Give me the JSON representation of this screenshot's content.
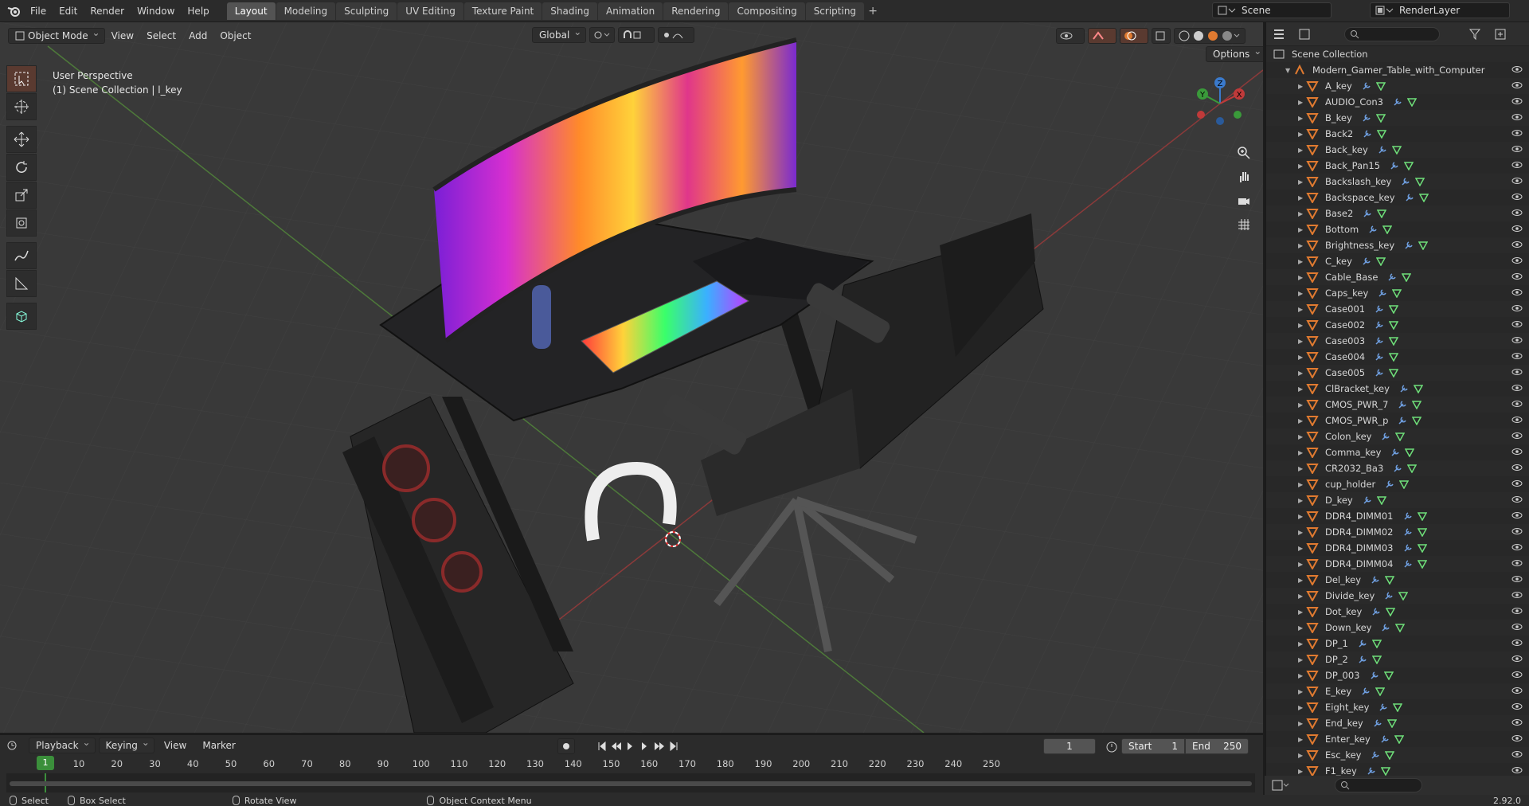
{
  "menubar": {
    "items": [
      "File",
      "Edit",
      "Render",
      "Window",
      "Help"
    ]
  },
  "workspaces": [
    "Layout",
    "Modeling",
    "Sculpting",
    "UV Editing",
    "Texture Paint",
    "Shading",
    "Animation",
    "Rendering",
    "Compositing",
    "Scripting"
  ],
  "active_workspace": "Layout",
  "scene": {
    "name": "Scene",
    "render_layer": "RenderLayer"
  },
  "viewport": {
    "mode": "Object Mode",
    "menus": [
      "View",
      "Select",
      "Add",
      "Object"
    ],
    "transform_orientation": "Global",
    "info_line1": "User Perspective",
    "info_line2": "(1) Scene Collection | l_key",
    "options_label": "Options"
  },
  "gizmo": {
    "x": "X",
    "y": "Y",
    "z": "Z"
  },
  "outliner": {
    "root": "Scene Collection",
    "collection": "Modern_Gamer_Table_with_Computer",
    "items": [
      "A_key",
      "AUDIO_Con3",
      "B_key",
      "Back2",
      "Back_key",
      "Back_Pan15",
      "Backslash_key",
      "Backspace_key",
      "Base2",
      "Bottom",
      "Brightness_key",
      "C_key",
      "Cable_Base",
      "Caps_key",
      "Case001",
      "Case002",
      "Case003",
      "Case004",
      "Case005",
      "ClBracket_key",
      "CMOS_PWR_7",
      "CMOS_PWR_p",
      "Colon_key",
      "Comma_key",
      "CR2032_Ba3",
      "cup_holder",
      "D_key",
      "DDR4_DIMM01",
      "DDR4_DIMM02",
      "DDR4_DIMM03",
      "DDR4_DIMM04",
      "Del_key",
      "Divide_key",
      "Dot_key",
      "Down_key",
      "DP_1",
      "DP_2",
      "DP_003",
      "E_key",
      "Eight_key",
      "End_key",
      "Enter_key",
      "Esc_key",
      "F1_key"
    ]
  },
  "timeline": {
    "menus": [
      "Playback",
      "Keying",
      "View",
      "Marker"
    ],
    "current_frame": "1",
    "start_label": "Start",
    "start": "1",
    "end_label": "End",
    "end": "250",
    "ticks": [
      "1",
      "10",
      "20",
      "30",
      "40",
      "50",
      "60",
      "70",
      "80",
      "90",
      "100",
      "110",
      "120",
      "130",
      "140",
      "150",
      "160",
      "170",
      "180",
      "190",
      "200",
      "210",
      "220",
      "230",
      "240",
      "250"
    ]
  },
  "statusbar": {
    "select": "Select",
    "box_select": "Box Select",
    "rotate_view": "Rotate View",
    "context_menu": "Object Context Menu",
    "version": "2.92.0"
  },
  "colors": {
    "accent_orange": "#e07a30",
    "frame_green": "#3b8f3b",
    "axis_red": "#c0392b",
    "axis_green": "#3a8f3a"
  }
}
